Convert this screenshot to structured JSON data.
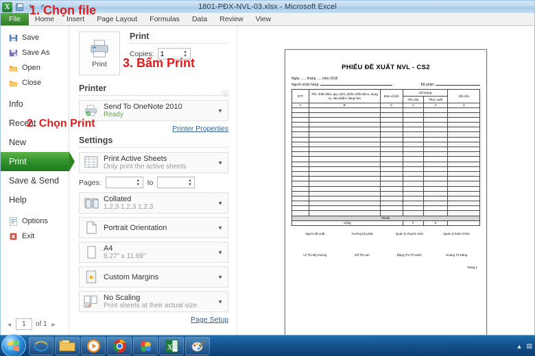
{
  "window": {
    "title": "1801-PĐX-NVL-03.xlsx  -  Microsoft Excel",
    "qat": [
      {
        "name": "excel-logo",
        "label": "X"
      },
      {
        "name": "save",
        "label": ""
      },
      {
        "name": "undo",
        "label": "↰"
      },
      {
        "name": "redo",
        "label": "↱"
      }
    ]
  },
  "ribbon": {
    "tabs": [
      {
        "label": "File"
      },
      {
        "label": "Home"
      },
      {
        "label": "Insert"
      },
      {
        "label": "Page Layout"
      },
      {
        "label": "Formulas"
      },
      {
        "label": "Data"
      },
      {
        "label": "Review"
      },
      {
        "label": "View"
      }
    ]
  },
  "nav": {
    "items": [
      {
        "label": "Save",
        "icon": "floppy-disk-icon"
      },
      {
        "label": "Save As",
        "icon": "save-as-icon"
      },
      {
        "label": "Open",
        "icon": "open-folder-icon"
      },
      {
        "label": "Close",
        "icon": "close-folder-icon"
      },
      {
        "label": "Info",
        "icon": ""
      },
      {
        "label": "Recent",
        "icon": ""
      },
      {
        "label": "New",
        "icon": ""
      },
      {
        "label": "Print",
        "icon": ""
      },
      {
        "label": "Save & Send",
        "icon": ""
      },
      {
        "label": "Help",
        "icon": ""
      },
      {
        "label": "Options",
        "icon": "options-icon"
      },
      {
        "label": "Exit",
        "icon": "exit-icon"
      }
    ]
  },
  "settings": {
    "print_heading": "Print",
    "print_button_label": "Print",
    "copies_label": "Copies:",
    "copies_value": "1",
    "printer_heading": "Printer",
    "printer_name": "Send To OneNote 2010",
    "printer_status": "Ready",
    "printer_properties_link": "Printer Properties",
    "settings_heading": "Settings",
    "options": [
      {
        "title": "Print Active Sheets",
        "subtitle": "Only print the active sheets",
        "icon": "sheets-icon"
      },
      {
        "title": "Collated",
        "subtitle": "1,2,3   1,2,3   1,2,3",
        "icon": "collate-icon"
      },
      {
        "title": "Portrait Orientation",
        "subtitle": "",
        "icon": "portrait-icon"
      },
      {
        "title": "A4",
        "subtitle": "8.27\" x 11.69\"",
        "icon": "paper-icon"
      },
      {
        "title": "Custom Margins",
        "subtitle": "",
        "icon": "margins-icon"
      },
      {
        "title": "No Scaling",
        "subtitle": "Print sheets at their actual size",
        "icon": "scaling-icon"
      }
    ],
    "pages_label": "Pages:",
    "pages_from": "",
    "pages_to_label": "to",
    "pages_to": "",
    "page_setup_link": "Page Setup"
  },
  "pager": {
    "current": "1",
    "of_label": "of 1"
  },
  "document": {
    "title": "PHIẾU ĐỀ XUẤT NVL - CS2",
    "date_line": "Ngày ...... tháng ......năm 2018",
    "receiver_label": "Người nhận hàng:",
    "department_label": "Bộ phận:",
    "headers": {
      "stt": "STT",
      "name": "Tên, nhãn hiệu, quy cách, phẩm chất vật tư, dụng cụ, sản phẩm, hàng hóa",
      "unit": "Đơn vị tính",
      "qty_group": "Số lượng",
      "qty_request": "Yêu cầu",
      "qty_issued": "Thực xuất",
      "note": "Ghi chú"
    },
    "letter_row": [
      "A",
      "B",
      "C",
      "1",
      "2",
      "3"
    ],
    "empty_rows": 22,
    "khoan_label": "khoản",
    "total_label": "Cộng",
    "total_request": "0",
    "total_issued": "0",
    "sign_titles": [
      "Người đề xuất",
      "Trưởng bộ phận",
      "Quản lý chuyên môn",
      "Quản lý hành chính"
    ],
    "sign_names": [
      "Lê Thị Mỹ Sương",
      "Đỗ Thị Lan",
      "Đặng Thị Tố Oanh",
      "Hoàng Trí Dũng"
    ],
    "page_footer": "Trang 1"
  },
  "annotations": [
    {
      "text": "1. Chọn file"
    },
    {
      "text": "2. Chọn Print"
    },
    {
      "text": "3. Bấm Print"
    }
  ],
  "taskbar": {
    "items": [
      {
        "name": "internet-explorer",
        "glyph": "e"
      },
      {
        "name": "windows-explorer",
        "glyph": ""
      },
      {
        "name": "media-player",
        "glyph": "▶"
      },
      {
        "name": "google-chrome",
        "glyph": ""
      },
      {
        "name": "app-colorful",
        "glyph": ""
      },
      {
        "name": "excel",
        "glyph": "X"
      },
      {
        "name": "paint",
        "glyph": ""
      }
    ]
  },
  "colors": {
    "accent_green": "#2e8f2a",
    "annotation_red": "#e01c1c",
    "link_blue": "#2a5d9e"
  }
}
